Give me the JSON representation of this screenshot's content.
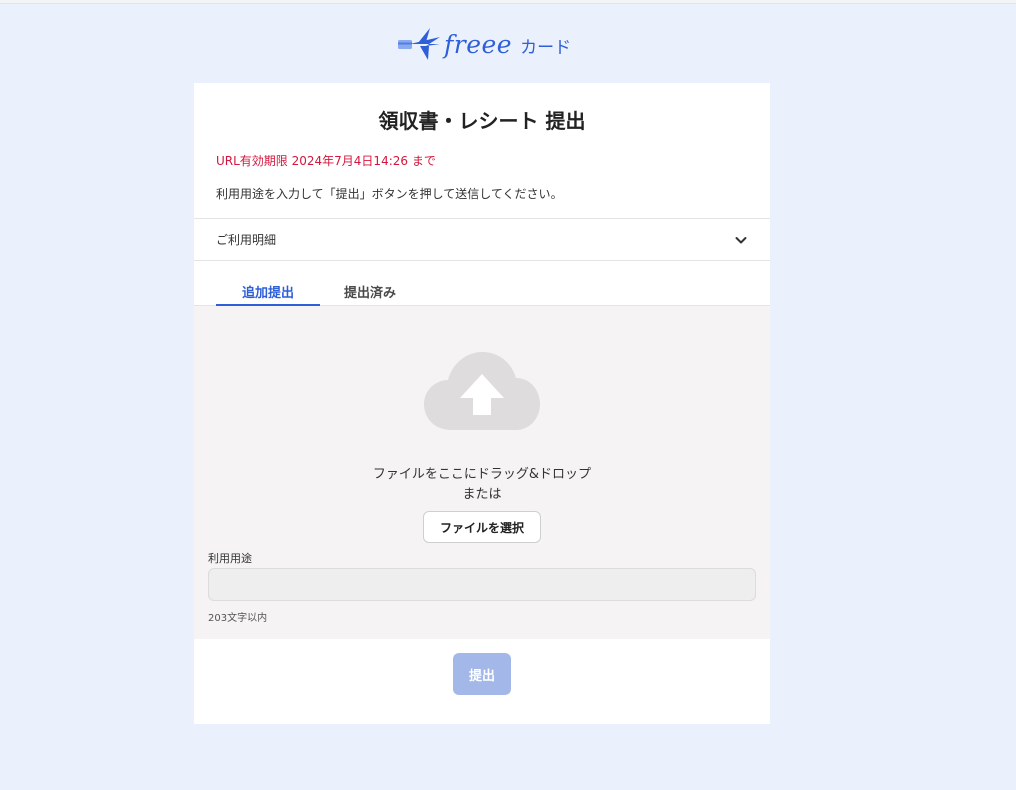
{
  "brand": {
    "name": "freee",
    "product": "カード",
    "primary_color": "#2e5fd9",
    "logo_icon": "plane-card-icon"
  },
  "page": {
    "title": "領収書・レシート 提出",
    "expiry": "URL有効期限 2024年7月4日14:26 まで",
    "instruction": "利用用途を入力して「提出」ボタンを押して送信してください。"
  },
  "accordion": {
    "label": "ご利用明細",
    "icon": "chevron-down-icon",
    "expanded": false
  },
  "tabs": [
    {
      "label": "追加提出",
      "active": true
    },
    {
      "label": "提出済み",
      "active": false
    }
  ],
  "upload": {
    "icon": "cloud-upload-icon",
    "drop_text": "ファイルをここにドラッグ&ドロップ",
    "or_text": "または",
    "select_button": "ファイルを選択"
  },
  "purpose": {
    "label": "利用用途",
    "value": "",
    "hint": "203文字以内"
  },
  "submit": {
    "label": "提出",
    "disabled": true
  }
}
